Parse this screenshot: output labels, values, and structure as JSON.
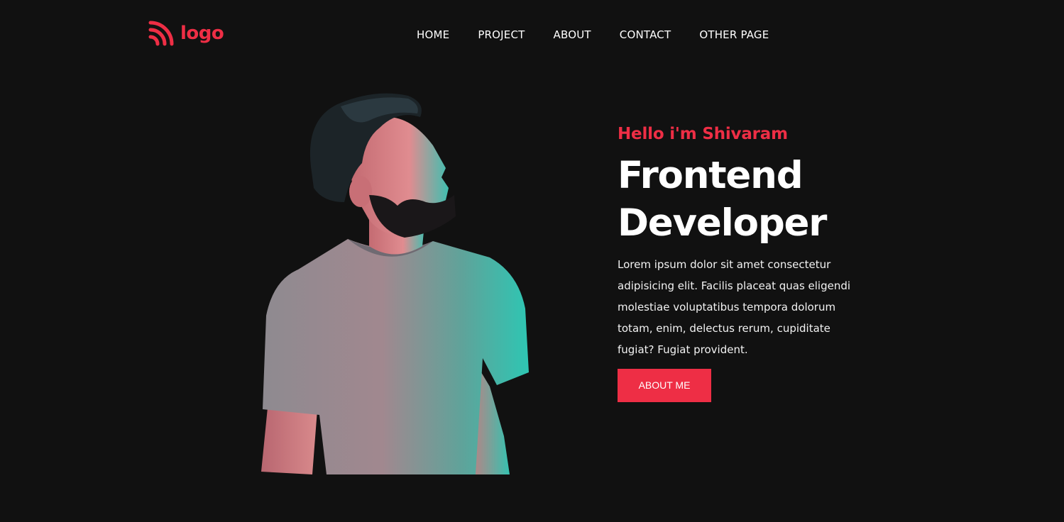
{
  "colors": {
    "background": "#111111",
    "accent": "#ee2e45",
    "text": "#ffffff"
  },
  "header": {
    "logo_icon": "rss-feed-icon",
    "logo_text": "logo",
    "nav": [
      {
        "label": "HOME"
      },
      {
        "label": "PROJECT"
      },
      {
        "label": "ABOUT"
      },
      {
        "label": "CONTACT"
      },
      {
        "label": "OTHER PAGE"
      }
    ]
  },
  "hero": {
    "greeting": "Hello i'm Shivaram",
    "title_line1": "Frontend",
    "title_line2": "Developer",
    "description": "Lorem ipsum dolor sit amet consectetur adipisicing elit. Facilis placeat quas eligendi molestiae voluptatibus tempora dolorum totam, enim, delectus rerum, cupiditate fugiat? Fugiat provident.",
    "cta_label": "ABOUT ME",
    "photo": "portrait of bearded man in t-shirt"
  }
}
